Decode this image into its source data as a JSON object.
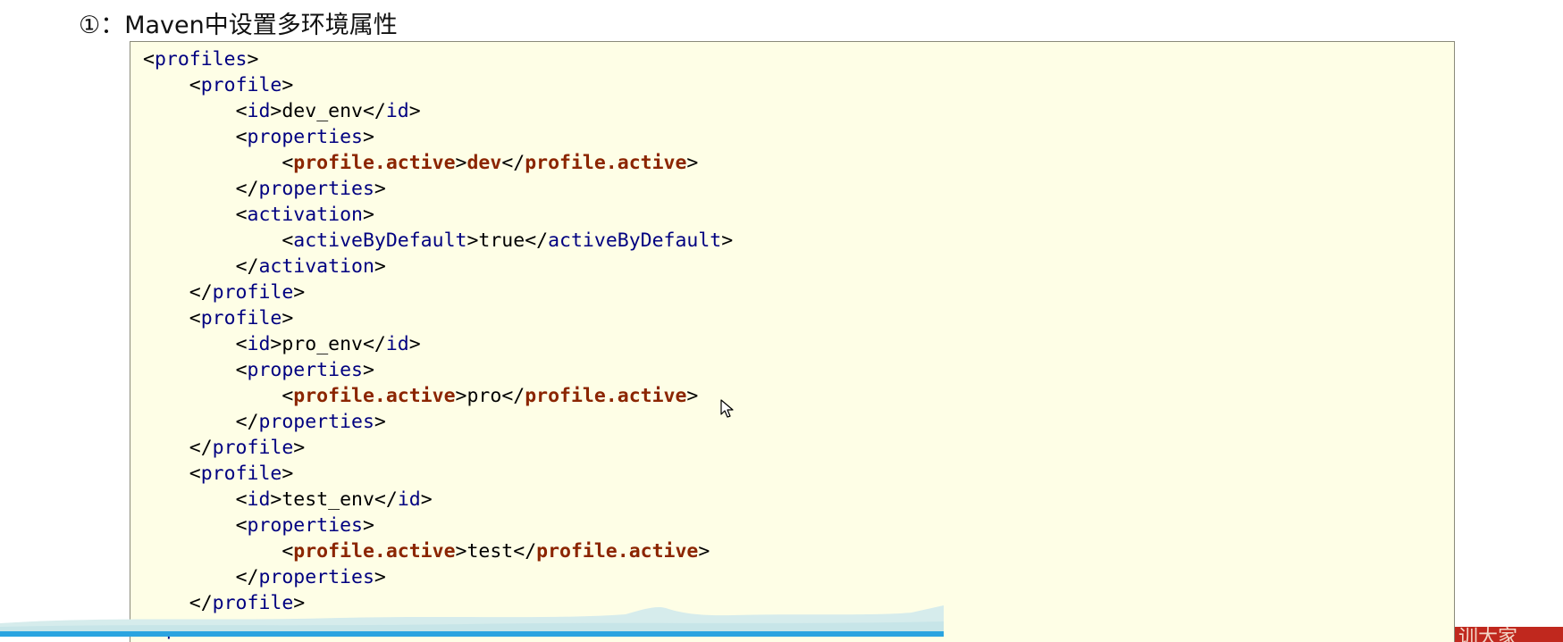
{
  "heading": "①：Maven中设置多环境属性",
  "code_lines": [
    {
      "indent": "",
      "parts": [
        [
          "b",
          "<"
        ],
        [
          "t",
          "profiles"
        ],
        [
          "b",
          ">"
        ]
      ]
    },
    {
      "indent": "    ",
      "parts": [
        [
          "b",
          "<"
        ],
        [
          "t",
          "profile"
        ],
        [
          "b",
          ">"
        ]
      ]
    },
    {
      "indent": "        ",
      "parts": [
        [
          "b",
          "<"
        ],
        [
          "t",
          "id"
        ],
        [
          "b",
          ">"
        ],
        [
          "x",
          "dev_env"
        ],
        [
          "b",
          "</"
        ],
        [
          "t",
          "id"
        ],
        [
          "b",
          ">"
        ]
      ]
    },
    {
      "indent": "        ",
      "parts": [
        [
          "b",
          "<"
        ],
        [
          "t",
          "properties"
        ],
        [
          "b",
          ">"
        ]
      ]
    },
    {
      "indent": "            ",
      "parts": [
        [
          "b",
          "<"
        ],
        [
          "k",
          "profile.active"
        ],
        [
          "b",
          ">"
        ],
        [
          "k",
          "dev"
        ],
        [
          "b",
          "</"
        ],
        [
          "k",
          "profile.active"
        ],
        [
          "b",
          ">"
        ]
      ]
    },
    {
      "indent": "        ",
      "parts": [
        [
          "b",
          "</"
        ],
        [
          "t",
          "properties"
        ],
        [
          "b",
          ">"
        ]
      ]
    },
    {
      "indent": "        ",
      "parts": [
        [
          "b",
          "<"
        ],
        [
          "t",
          "activation"
        ],
        [
          "b",
          ">"
        ]
      ]
    },
    {
      "indent": "            ",
      "parts": [
        [
          "b",
          "<"
        ],
        [
          "t",
          "activeByDefault"
        ],
        [
          "b",
          ">"
        ],
        [
          "x",
          "true"
        ],
        [
          "b",
          "</"
        ],
        [
          "t",
          "activeByDefault"
        ],
        [
          "b",
          ">"
        ]
      ]
    },
    {
      "indent": "        ",
      "parts": [
        [
          "b",
          "</"
        ],
        [
          "t",
          "activation"
        ],
        [
          "b",
          ">"
        ]
      ]
    },
    {
      "indent": "    ",
      "parts": [
        [
          "b",
          "</"
        ],
        [
          "t",
          "profile"
        ],
        [
          "b",
          ">"
        ]
      ]
    },
    {
      "indent": "    ",
      "parts": [
        [
          "b",
          "<"
        ],
        [
          "t",
          "profile"
        ],
        [
          "b",
          ">"
        ]
      ]
    },
    {
      "indent": "        ",
      "parts": [
        [
          "b",
          "<"
        ],
        [
          "t",
          "id"
        ],
        [
          "b",
          ">"
        ],
        [
          "x",
          "pro_env"
        ],
        [
          "b",
          "</"
        ],
        [
          "t",
          "id"
        ],
        [
          "b",
          ">"
        ]
      ]
    },
    {
      "indent": "        ",
      "parts": [
        [
          "b",
          "<"
        ],
        [
          "t",
          "properties"
        ],
        [
          "b",
          ">"
        ]
      ]
    },
    {
      "indent": "            ",
      "parts": [
        [
          "b",
          "<"
        ],
        [
          "k",
          "profile.active"
        ],
        [
          "b",
          ">"
        ],
        [
          "x",
          "pro"
        ],
        [
          "b",
          "</"
        ],
        [
          "k",
          "profile.active"
        ],
        [
          "b",
          ">"
        ]
      ]
    },
    {
      "indent": "        ",
      "parts": [
        [
          "b",
          "</"
        ],
        [
          "t",
          "properties"
        ],
        [
          "b",
          ">"
        ]
      ]
    },
    {
      "indent": "    ",
      "parts": [
        [
          "b",
          "</"
        ],
        [
          "t",
          "profile"
        ],
        [
          "b",
          ">"
        ]
      ]
    },
    {
      "indent": "    ",
      "parts": [
        [
          "b",
          "<"
        ],
        [
          "t",
          "profile"
        ],
        [
          "b",
          ">"
        ]
      ]
    },
    {
      "indent": "        ",
      "parts": [
        [
          "b",
          "<"
        ],
        [
          "t",
          "id"
        ],
        [
          "b",
          ">"
        ],
        [
          "x",
          "test_env"
        ],
        [
          "b",
          "</"
        ],
        [
          "t",
          "id"
        ],
        [
          "b",
          ">"
        ]
      ]
    },
    {
      "indent": "        ",
      "parts": [
        [
          "b",
          "<"
        ],
        [
          "t",
          "properties"
        ],
        [
          "b",
          ">"
        ]
      ]
    },
    {
      "indent": "            ",
      "parts": [
        [
          "b",
          "<"
        ],
        [
          "k",
          "profile.active"
        ],
        [
          "b",
          ">"
        ],
        [
          "x",
          "test"
        ],
        [
          "b",
          "</"
        ],
        [
          "k",
          "profile.active"
        ],
        [
          "b",
          ">"
        ]
      ]
    },
    {
      "indent": "        ",
      "parts": [
        [
          "b",
          "</"
        ],
        [
          "t",
          "properties"
        ],
        [
          "b",
          ">"
        ]
      ]
    },
    {
      "indent": "    ",
      "parts": [
        [
          "b",
          "</"
        ],
        [
          "t",
          "profile"
        ],
        [
          "b",
          ">"
        ]
      ]
    },
    {
      "indent": "",
      "parts": [
        [
          "b",
          "</"
        ],
        [
          "t",
          "profiles"
        ],
        [
          "b",
          ">"
        ]
      ]
    }
  ],
  "badge_text": "训大家",
  "colors": {
    "code_background": "#fefee6",
    "tag": "#000080",
    "keyword": "#8b2500",
    "progress_bar": "#2aa4e0",
    "badge": "#c0281e"
  },
  "icons": {
    "cursor": "mouse-pointer-icon"
  }
}
